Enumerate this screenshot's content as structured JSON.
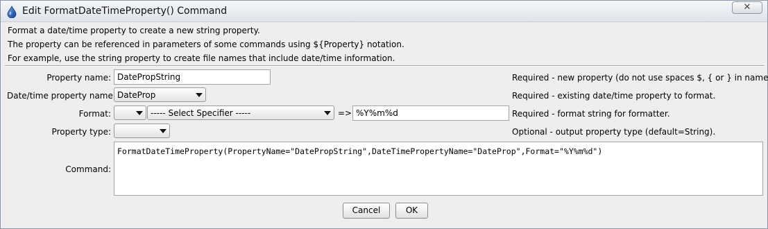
{
  "window": {
    "title": "Edit FormatDateTimeProperty() Command",
    "close_glyph": "✕",
    "icon": "droplet-icon"
  },
  "description": {
    "line1": "Format a date/time property to create a new string property.",
    "line2": "The property can be referenced in parameters of some commands using ${Property} notation.",
    "line3": "For example, use the string property to create file names that include date/time information."
  },
  "form": {
    "property_name": {
      "label": "Property name:",
      "value": "DatePropString",
      "hint": "Required - new property (do not use spaces $, { or } in name)."
    },
    "datetime_property": {
      "label": "Date/time property name:",
      "selected": "DateProp",
      "hint": "Required - existing date/time property to format."
    },
    "format": {
      "label": "Format:",
      "type_selected": "",
      "specifier_selected": "----- Select Specifier -----",
      "arrow_text": "=>",
      "value": "%Y%m%d",
      "hint": "Required - format string for formatter."
    },
    "property_type": {
      "label": "Property type:",
      "selected": "",
      "hint": "Optional - output property type (default=String)."
    },
    "command": {
      "label": "Command:",
      "value": "FormatDateTimeProperty(PropertyName=\"DatePropString\",DateTimePropertyName=\"DateProp\",Format=\"%Y%m%d\")"
    }
  },
  "buttons": {
    "cancel": "Cancel",
    "ok": "OK"
  }
}
